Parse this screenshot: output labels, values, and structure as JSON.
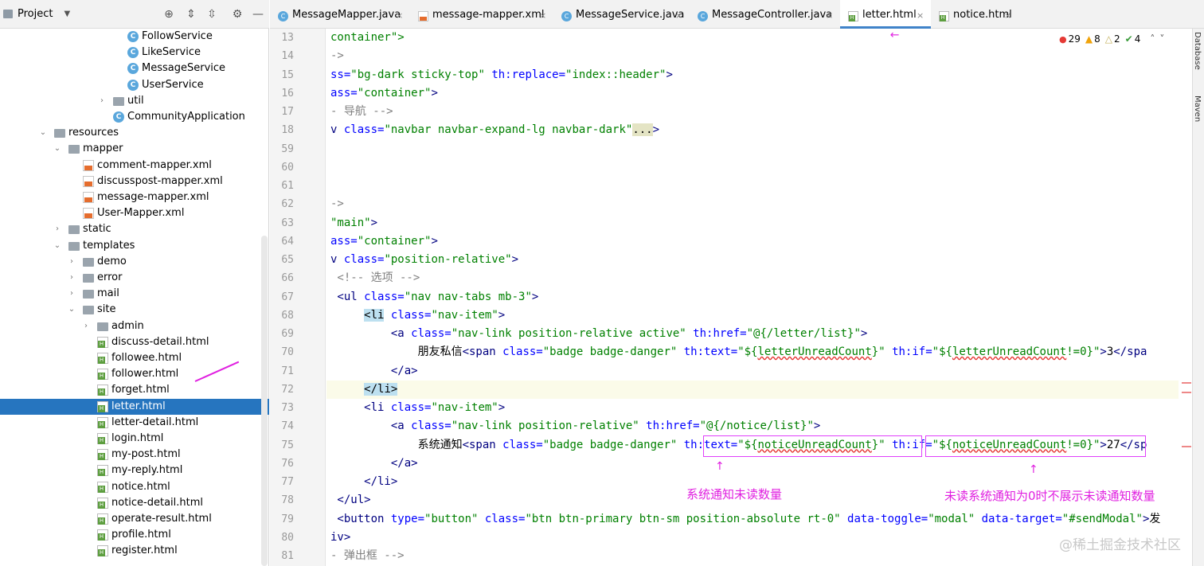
{
  "project": {
    "title": "Project",
    "tree": [
      {
        "label": "FollowService",
        "icon": "class",
        "indent": 160,
        "arrow": ""
      },
      {
        "label": "LikeService",
        "icon": "class",
        "indent": 160,
        "arrow": ""
      },
      {
        "label": "MessageService",
        "icon": "class",
        "indent": 160,
        "arrow": ""
      },
      {
        "label": "UserService",
        "icon": "class",
        "indent": 160,
        "arrow": ""
      },
      {
        "label": "util",
        "icon": "folder",
        "indent": 142,
        "arrow": "›"
      },
      {
        "label": "CommunityApplication",
        "icon": "class",
        "indent": 142,
        "arrow": ""
      },
      {
        "label": "resources",
        "icon": "folder",
        "indent": 68,
        "arrow": "⌄"
      },
      {
        "label": "mapper",
        "icon": "folder",
        "indent": 86,
        "arrow": "⌄"
      },
      {
        "label": "comment-mapper.xml",
        "icon": "xml",
        "indent": 104,
        "arrow": ""
      },
      {
        "label": "discusspost-mapper.xml",
        "icon": "xml",
        "indent": 104,
        "arrow": ""
      },
      {
        "label": "message-mapper.xml",
        "icon": "xml",
        "indent": 104,
        "arrow": ""
      },
      {
        "label": "User-Mapper.xml",
        "icon": "xml",
        "indent": 104,
        "arrow": ""
      },
      {
        "label": "static",
        "icon": "folder",
        "indent": 86,
        "arrow": "›"
      },
      {
        "label": "templates",
        "icon": "folder",
        "indent": 86,
        "arrow": "⌄"
      },
      {
        "label": "demo",
        "icon": "folder",
        "indent": 104,
        "arrow": "›"
      },
      {
        "label": "error",
        "icon": "folder",
        "indent": 104,
        "arrow": "›"
      },
      {
        "label": "mail",
        "icon": "folder",
        "indent": 104,
        "arrow": "›"
      },
      {
        "label": "site",
        "icon": "folder",
        "indent": 104,
        "arrow": "⌄"
      },
      {
        "label": "admin",
        "icon": "folder",
        "indent": 122,
        "arrow": "›"
      },
      {
        "label": "discuss-detail.html",
        "icon": "html",
        "indent": 122,
        "arrow": ""
      },
      {
        "label": "followee.html",
        "icon": "html",
        "indent": 122,
        "arrow": ""
      },
      {
        "label": "follower.html",
        "icon": "html",
        "indent": 122,
        "arrow": ""
      },
      {
        "label": "forget.html",
        "icon": "html",
        "indent": 122,
        "arrow": ""
      },
      {
        "label": "letter.html",
        "icon": "html",
        "indent": 122,
        "arrow": "",
        "selected": true
      },
      {
        "label": "letter-detail.html",
        "icon": "html",
        "indent": 122,
        "arrow": ""
      },
      {
        "label": "login.html",
        "icon": "html",
        "indent": 122,
        "arrow": ""
      },
      {
        "label": "my-post.html",
        "icon": "html",
        "indent": 122,
        "arrow": ""
      },
      {
        "label": "my-reply.html",
        "icon": "html",
        "indent": 122,
        "arrow": ""
      },
      {
        "label": "notice.html",
        "icon": "html",
        "indent": 122,
        "arrow": ""
      },
      {
        "label": "notice-detail.html",
        "icon": "html",
        "indent": 122,
        "arrow": ""
      },
      {
        "label": "operate-result.html",
        "icon": "html",
        "indent": 122,
        "arrow": ""
      },
      {
        "label": "profile.html",
        "icon": "html",
        "indent": 122,
        "arrow": ""
      },
      {
        "label": "register.html",
        "icon": "html",
        "indent": 122,
        "arrow": ""
      }
    ]
  },
  "tabs": [
    {
      "label": "MessageMapper.java",
      "icon": "class"
    },
    {
      "label": "message-mapper.xml",
      "icon": "xml"
    },
    {
      "label": "MessageService.java",
      "icon": "class"
    },
    {
      "label": "MessageController.java",
      "icon": "class"
    },
    {
      "label": "letter.html",
      "icon": "html",
      "active": true
    },
    {
      "label": "notice.html",
      "icon": "html"
    }
  ],
  "inspections": {
    "errors": "29",
    "warnings": "8",
    "weak": "2",
    "ok": "4"
  },
  "line_numbers": [
    "13",
    "14",
    "15",
    "16",
    "17",
    "18",
    "59",
    "60",
    "61",
    "62",
    "63",
    "64",
    "65",
    "66",
    "67",
    "68",
    "69",
    "70",
    "71",
    "72",
    "73",
    "74",
    "75",
    "76",
    "77",
    "78",
    "79",
    "80",
    "81"
  ],
  "code_lines": [
    [
      {
        "c": "v",
        "t": "container\">"
      }
    ],
    [
      {
        "c": "cm",
        "t": "->"
      }
    ],
    [
      {
        "c": "a",
        "t": "ss="
      },
      {
        "c": "v",
        "t": "\"bg-dark sticky-top\" "
      },
      {
        "c": "a",
        "t": "th:replace="
      },
      {
        "c": "v",
        "t": "\"index::header\""
      },
      {
        "c": "t",
        "t": ">"
      }
    ],
    [
      {
        "c": "a",
        "t": "ass="
      },
      {
        "c": "v",
        "t": "\"container\""
      },
      {
        "c": "t",
        "t": ">"
      }
    ],
    [
      {
        "c": "cm",
        "t": "- 导航 -->"
      }
    ],
    [
      {
        "c": "t",
        "t": "v "
      },
      {
        "c": "a",
        "t": "class="
      },
      {
        "c": "v",
        "t": "\"navbar navbar-expand-lg navbar-dark\""
      },
      {
        "c": "fold",
        "t": "..."
      },
      {
        "c": "t",
        "t": ">"
      }
    ],
    [],
    [],
    [],
    [
      {
        "c": "cm",
        "t": "->"
      }
    ],
    [
      {
        "c": "v",
        "t": "\"main\""
      },
      {
        "c": "t",
        "t": ">"
      }
    ],
    [
      {
        "c": "a",
        "t": "ass="
      },
      {
        "c": "v",
        "t": "\"container\""
      },
      {
        "c": "t",
        "t": ">"
      }
    ],
    [
      {
        "c": "t",
        "t": "v "
      },
      {
        "c": "a",
        "t": "class="
      },
      {
        "c": "v",
        "t": "\"position-relative\""
      },
      {
        "c": "t",
        "t": ">"
      }
    ],
    [
      {
        "c": "cm",
        "t": " <!-- 选项 -->"
      }
    ],
    [
      {
        "c": "t",
        "t": " <ul "
      },
      {
        "c": "a",
        "t": "class="
      },
      {
        "c": "v",
        "t": "\"nav nav-tabs mb-3\""
      },
      {
        "c": "t",
        "t": ">"
      }
    ],
    [
      {
        "c": "t",
        "t": "     "
      },
      {
        "c": "hl",
        "t": "<li"
      },
      {
        "c": "t",
        "t": " "
      },
      {
        "c": "a",
        "t": "class="
      },
      {
        "c": "v",
        "t": "\"nav-item\""
      },
      {
        "c": "t",
        "t": ">"
      }
    ],
    [
      {
        "c": "t",
        "t": "         <a "
      },
      {
        "c": "a",
        "t": "class="
      },
      {
        "c": "v",
        "t": "\"nav-link position-relative active\" "
      },
      {
        "c": "a",
        "t": "th:href="
      },
      {
        "c": "v",
        "t": "\"@{/letter/list}\""
      },
      {
        "c": "t",
        "t": ">"
      }
    ],
    [
      {
        "c": "v2",
        "t": "             朋友私信"
      },
      {
        "c": "t",
        "t": "<span "
      },
      {
        "c": "a",
        "t": "class="
      },
      {
        "c": "v",
        "t": "\"badge badge-danger\" "
      },
      {
        "c": "a",
        "t": "th:text="
      },
      {
        "c": "v",
        "t": "\"${"
      },
      {
        "c": "wv",
        "t": "letterUnreadCount"
      },
      {
        "c": "v",
        "t": "}\" "
      },
      {
        "c": "a",
        "t": "th:if="
      },
      {
        "c": "v",
        "t": "\"${"
      },
      {
        "c": "wv",
        "t": "letterUnreadCount"
      },
      {
        "c": "v",
        "t": "!=0}\""
      },
      {
        "c": "t",
        "t": ">"
      },
      {
        "c": "v2",
        "t": "3"
      },
      {
        "c": "t",
        "t": "</spa"
      }
    ],
    [
      {
        "c": "t",
        "t": "         </a>"
      }
    ],
    [
      {
        "c": "t",
        "t": "     "
      },
      {
        "c": "hl",
        "t": "</li>"
      }
    ],
    [
      {
        "c": "t",
        "t": "     <li "
      },
      {
        "c": "a",
        "t": "class="
      },
      {
        "c": "v",
        "t": "\"nav-item\""
      },
      {
        "c": "t",
        "t": ">"
      }
    ],
    [
      {
        "c": "t",
        "t": "         <a "
      },
      {
        "c": "a",
        "t": "class="
      },
      {
        "c": "v",
        "t": "\"nav-link position-relative\" "
      },
      {
        "c": "a",
        "t": "th:href="
      },
      {
        "c": "v",
        "t": "\"@{/notice/list}\""
      },
      {
        "c": "t",
        "t": ">"
      }
    ],
    [
      {
        "c": "v2",
        "t": "             系统通知"
      },
      {
        "c": "t",
        "t": "<span "
      },
      {
        "c": "a",
        "t": "class="
      },
      {
        "c": "v",
        "t": "\"badge badge-danger\" "
      },
      {
        "c": "a",
        "t": "th:text="
      },
      {
        "c": "v",
        "t": "\"${"
      },
      {
        "c": "wv",
        "t": "noticeUnreadCount"
      },
      {
        "c": "v",
        "t": "}\" "
      },
      {
        "c": "a",
        "t": "th:if="
      },
      {
        "c": "v",
        "t": "\"${"
      },
      {
        "c": "wv",
        "t": "noticeUnreadCount"
      },
      {
        "c": "v",
        "t": "!=0}\""
      },
      {
        "c": "t",
        "t": ">"
      },
      {
        "c": "v2",
        "t": "27"
      },
      {
        "c": "t",
        "t": "</sp"
      }
    ],
    [
      {
        "c": "t",
        "t": "         </a>"
      }
    ],
    [
      {
        "c": "t",
        "t": "     </li>"
      }
    ],
    [
      {
        "c": "t",
        "t": " </ul>"
      }
    ],
    [
      {
        "c": "t",
        "t": " <button "
      },
      {
        "c": "a",
        "t": "type="
      },
      {
        "c": "v",
        "t": "\"button\" "
      },
      {
        "c": "a",
        "t": "class="
      },
      {
        "c": "v",
        "t": "\"btn btn-primary btn-sm position-absolute rt-0\" "
      },
      {
        "c": "a",
        "t": "data-toggle="
      },
      {
        "c": "v",
        "t": "\"modal\" "
      },
      {
        "c": "a",
        "t": "data-target="
      },
      {
        "c": "v",
        "t": "\"#sendModal\""
      },
      {
        "c": "t",
        "t": ">"
      },
      {
        "c": "v2",
        "t": "发"
      }
    ],
    [
      {
        "c": "t",
        "t": "iv>"
      }
    ],
    [
      {
        "c": "cm",
        "t": "- 弹出框 -->"
      }
    ]
  ],
  "annotations": {
    "left": "系统通知未读数量",
    "right": "未读系统通知为0时不展示未读通知数量"
  },
  "rightbar": {
    "database": "Database",
    "maven": "Maven"
  },
  "watermark": "@稀土掘金技术社区"
}
